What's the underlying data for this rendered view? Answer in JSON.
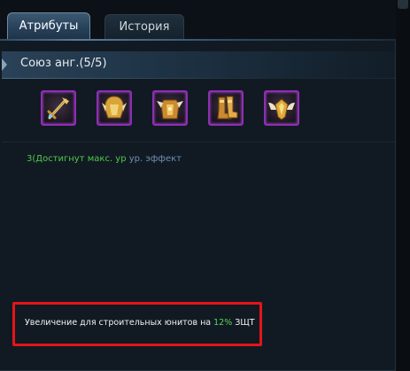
{
  "tabs": [
    {
      "label": "Атрибуты",
      "active": true
    },
    {
      "label": "История",
      "active": false
    }
  ],
  "set": {
    "title": "Союз анг.(5/5)"
  },
  "items": [
    {
      "icon": "golden-sword-icon"
    },
    {
      "icon": "golden-helmet-icon"
    },
    {
      "icon": "golden-armor-icon"
    },
    {
      "icon": "golden-boots-icon"
    },
    {
      "icon": "winged-emblem-icon"
    }
  ],
  "effect": {
    "prefix": "3(Достигнут макс. ур",
    "suffix": " ур. эффект"
  },
  "bonus": {
    "text_before": "Увеличение для строительных юнитов на ",
    "percent": "12%",
    "text_after": " ЗЩТ"
  },
  "colors": {
    "slot_border": "#8d2fb4",
    "highlight": "#e5141a",
    "green": "#4ec94e",
    "gold": "#d9a53a"
  }
}
